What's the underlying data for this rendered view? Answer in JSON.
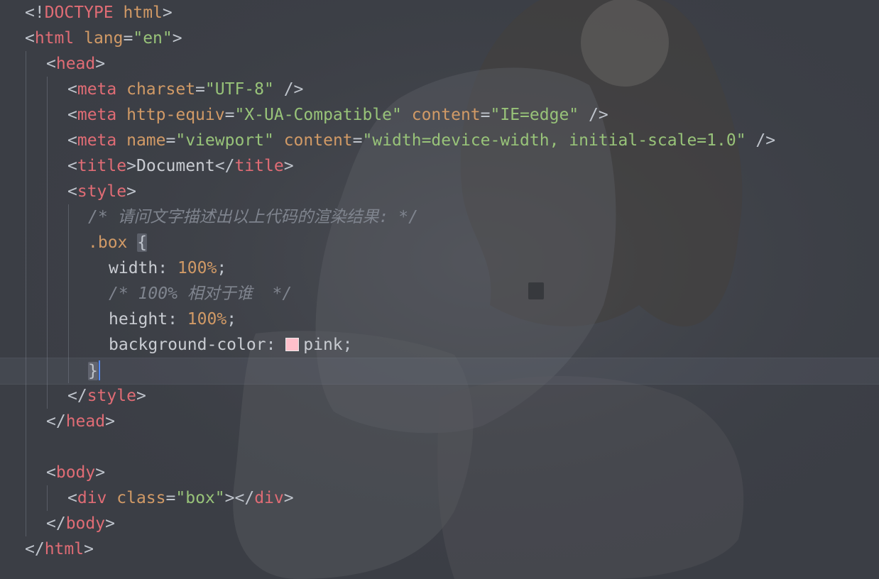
{
  "colors": {
    "background": "#3b3e45",
    "tag": "#e06c75",
    "attribute": "#d19a66",
    "string": "#98c379",
    "comment": "#7f848e",
    "text": "#c9ccd2",
    "swatch_pink": "#ffc0cb",
    "caret": "#528bff"
  },
  "code": {
    "l1": {
      "open": "<!",
      "tag": "DOCTYPE",
      "attr": "html",
      "close": ">"
    },
    "l2": {
      "open": "<",
      "tag": "html",
      "attr": "lang",
      "eq": "=",
      "val": "\"en\"",
      "close": ">"
    },
    "l3": {
      "open": "<",
      "tag": "head",
      "close": ">"
    },
    "l4": {
      "open": "<",
      "tag": "meta",
      "attr": "charset",
      "eq": "=",
      "val": "\"UTF-8\"",
      "close": "/>"
    },
    "l5": {
      "open": "<",
      "tag": "meta",
      "attr1": "http-equiv",
      "eq1": "=",
      "val1": "\"X-UA-Compatible\"",
      "attr2": "content",
      "eq2": "=",
      "val2": "\"IE=edge\"",
      "close": "/>"
    },
    "l6": {
      "open": "<",
      "tag": "meta",
      "attr1": "name",
      "eq1": "=",
      "val1": "\"viewport\"",
      "attr2": "content",
      "eq2": "=",
      "val2": "\"width=device-width, initial-scale=1.0\"",
      "close": "/>"
    },
    "l7": {
      "open": "<",
      "tag": "title",
      "close1": ">",
      "text": "Document",
      "open2": "</",
      "tag2": "title",
      "close2": ">"
    },
    "l8": {
      "open": "<",
      "tag": "style",
      "close": ">"
    },
    "l9": {
      "comment": "/* 请问文字描述出以上代码的渲染结果: */"
    },
    "l10": {
      "selector": ".box",
      "brace": "{"
    },
    "l11": {
      "prop": "width",
      "colon": ": ",
      "num": "100%",
      "semi": ";"
    },
    "l12": {
      "comment": "/* 100% 相对于谁  */"
    },
    "l13": {
      "prop": "height",
      "colon": ": ",
      "num": "100%",
      "semi": ";"
    },
    "l14": {
      "prop": "background-color",
      "colon": ": ",
      "value": "pink",
      "semi": ";"
    },
    "l15": {
      "brace": "}"
    },
    "l16": {
      "open": "</",
      "tag": "style",
      "close": ">"
    },
    "l17": {
      "open": "</",
      "tag": "head",
      "close": ">"
    },
    "l19": {
      "open": "<",
      "tag": "body",
      "close": ">"
    },
    "l20": {
      "open": "<",
      "tag": "div",
      "attr": "class",
      "eq": "=",
      "val": "\"box\"",
      "close1": ">",
      "open2": "</",
      "tag2": "div",
      "close2": ">"
    },
    "l21": {
      "open": "</",
      "tag": "body",
      "close": ">"
    },
    "l22": {
      "open": "</",
      "tag": "html",
      "close": ">"
    }
  }
}
